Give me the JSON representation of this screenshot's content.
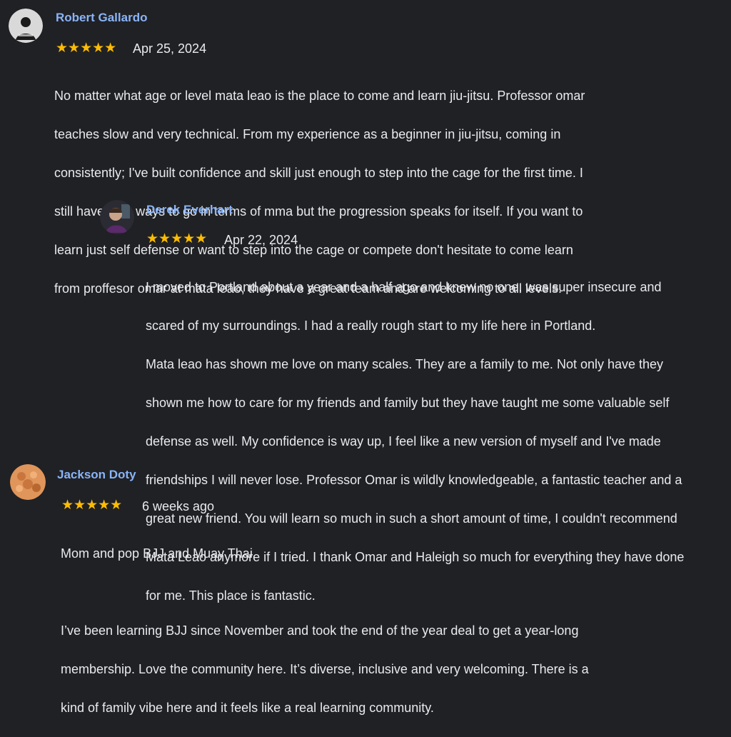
{
  "colors": {
    "background": "#202124",
    "author_link": "#8ab4f8",
    "star": "#fbbc04",
    "text": "#e8eaed"
  },
  "reviews": [
    {
      "author": "Robert Gallardo",
      "avatar_icon": "person-avatar",
      "stars": "★★★★★",
      "rating": 5,
      "date": "Apr 25, 2024",
      "lines": [
        "No matter what age or level mata leao is the place to come and learn jiu-jitsu. Professor omar",
        "teaches slow and very technical. From my experience as a beginner in jiu-jitsu, coming in",
        "consistently; I've built confidence and skill just enough to step into the cage for the first time. I",
        "still have long ways to go in terms of mma but the progression speaks for itself. If you want to",
        "learn just self defense or want to step into the cage or compete don't hesitate to come learn",
        "from proffesor omar at mata leao, they have a great team and are welcoming to all levels."
      ]
    },
    {
      "author": "Derek Everhart",
      "avatar_icon": "person-avatar",
      "stars": "★★★★★",
      "rating": 5,
      "date": "Apr 22, 2024",
      "lines": [
        "I moved to Portland about a year and a half ago and knew no one, was super insecure and",
        "scared of my surroundings. I had a really rough start to my life here in Portland.",
        "Mata leao has shown me love on many scales. They are a family to me. Not only have they",
        "shown me how to care for my friends and family but they have taught me some valuable self",
        "defense as well. My confidence is way up, I feel like a new version of myself and I've made",
        "friendships I will never lose. Professor Omar is wildly knowledgeable, a fantastic teacher and a",
        "great new friend. You will learn so much in such a short amount of time, I couldn't recommend",
        "Mata Leao anymore if I tried. I thank Omar and Haleigh so much for everything they have done",
        "for me. This place is fantastic."
      ]
    },
    {
      "author": "Jackson Doty",
      "avatar_icon": "person-avatar",
      "stars": "★★★★★",
      "rating": 5,
      "date": "6 weeks ago",
      "lines": [
        "Mom and pop BJJ and Muay Thai",
        "",
        "I’ve been learning BJJ since November and took the end of the year deal to get a year-long",
        "membership. Love the community here. It’s diverse, inclusive and very welcoming. There is a",
        "kind of family vibe here and it feels like a real learning community."
      ]
    }
  ]
}
